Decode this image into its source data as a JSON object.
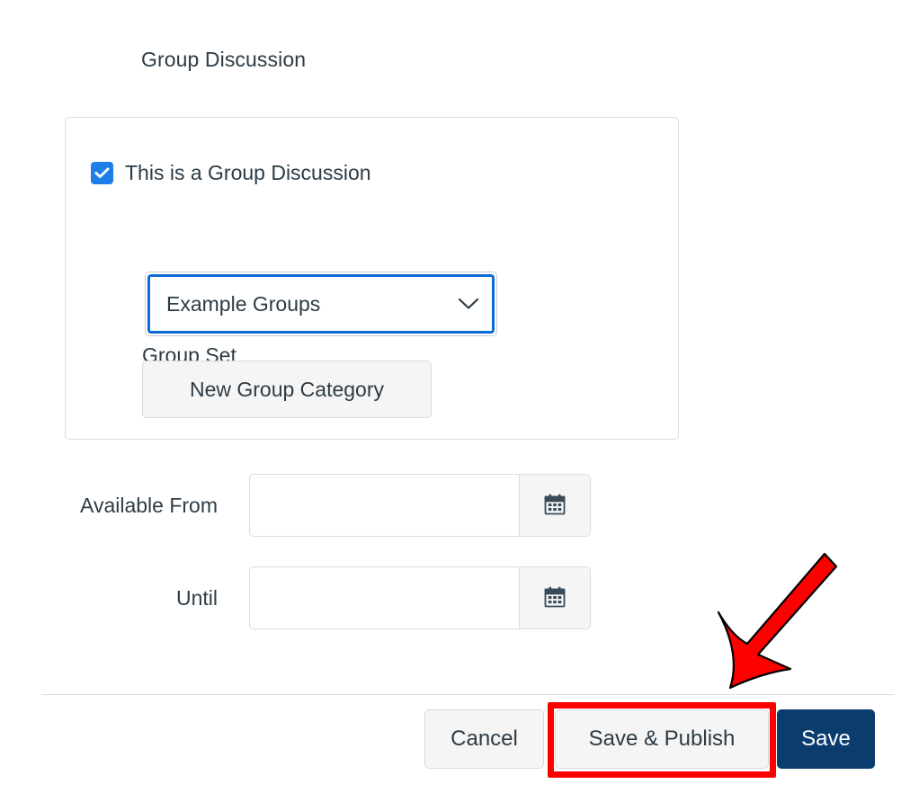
{
  "page": {
    "heading": "Group Discussion"
  },
  "group_panel": {
    "checkbox": {
      "label": "This is a Group Discussion",
      "checked": true,
      "icon": "checkmark-icon",
      "color": "#1e7fe8"
    },
    "group_set": {
      "label": "Group Set",
      "selected_value": "Example Groups",
      "options": [
        "Example Groups"
      ],
      "chevron_icon": "chevron-down-icon",
      "focused": true,
      "focus_color": "#0a6cd4"
    },
    "new_group_category_button": "New Group Category"
  },
  "dates": {
    "rows": [
      {
        "label": "Available From",
        "value": "",
        "placeholder": "",
        "icon": "calendar-icon"
      },
      {
        "label": "Until",
        "value": "",
        "placeholder": "",
        "icon": "calendar-icon"
      }
    ]
  },
  "footer": {
    "cancel_label": "Cancel",
    "save_publish_label": "Save & Publish",
    "save_label": "Save",
    "save_button_color": "#0b3c6e"
  },
  "annotations": {
    "highlight_color": "#fd0000",
    "highlight_target": "Save & Publish",
    "arrow_color": "#fd0000",
    "arrow_direction": "down-left"
  }
}
